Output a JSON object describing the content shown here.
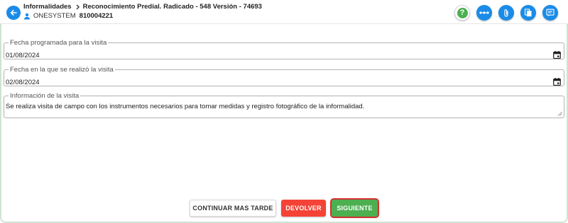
{
  "header": {
    "module": "Informalidades",
    "title": "Reconocimiento Predial. Radicado - 548 Versión - 74693",
    "organization": "ONESYSTEM",
    "nit": "810004221",
    "icons": {
      "back": "arrow-left-icon",
      "help": "question-icon",
      "more": "more-horizontal-icon",
      "attach": "paperclip-icon",
      "documents": "documents-icon",
      "notes": "notes-icon"
    },
    "help_symbol": "?",
    "colors": {
      "primary": "#1a8be8",
      "help": "#4caf50"
    }
  },
  "form": {
    "scheduled_date": {
      "label": "Fecha programada para la visita",
      "value": "01/08/2024"
    },
    "performed_date": {
      "label": "Fecha en la que se realizó la visita",
      "value": "02/08/2024"
    },
    "visit_info": {
      "label": "Información de la visita",
      "value": "Se realiza visita de campo con los instrumentos necesarios para tomar medidas y registro fotográfico de la informalidad."
    }
  },
  "actions": {
    "later_label": "CONTINUAR MAS TARDE",
    "return_label": "DEVOLVER",
    "next_label": "SIGUIENTE",
    "colors": {
      "return": "#f44336",
      "next": "#4caf50",
      "highlight": "#d32f2f"
    }
  }
}
